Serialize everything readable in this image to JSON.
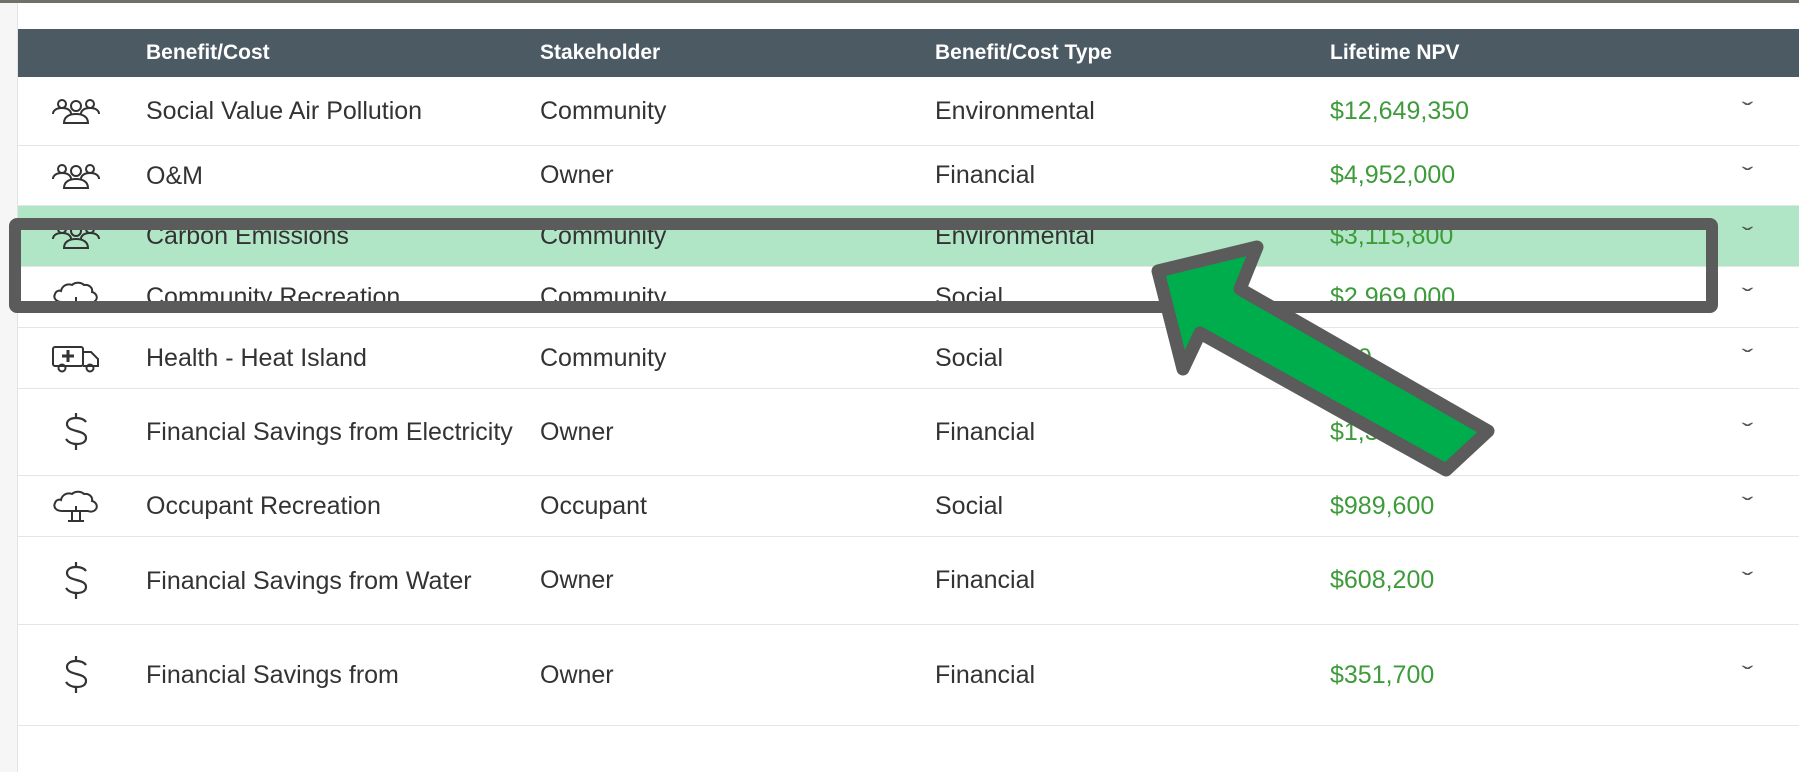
{
  "table": {
    "headers": {
      "benefit_cost": "Benefit/Cost",
      "stakeholder": "Stakeholder",
      "type": "Benefit/Cost Type",
      "npv": "Lifetime NPV"
    },
    "rows": [
      {
        "icon": "people-icon",
        "name": "Social Value Air Pollution",
        "stakeholder": "Community",
        "type": "Environmental",
        "npv": "$12,649,350"
      },
      {
        "icon": "people-icon",
        "name": "O&M",
        "stakeholder": "Owner",
        "type": "Financial",
        "npv": "$4,952,000"
      },
      {
        "icon": "people-icon",
        "name": "Carbon Emissions",
        "stakeholder": "Community",
        "type": "Environmental",
        "npv": "$3,115,800"
      },
      {
        "icon": "tree-icon",
        "name": "Community Recreation",
        "stakeholder": "Community",
        "type": "Social",
        "npv": "$2,969,000"
      },
      {
        "icon": "ambulance-icon",
        "name": "Health - Heat Island",
        "stakeholder": "Community",
        "type": "Social",
        "npv": "800"
      },
      {
        "icon": "dollar-icon",
        "name": "Financial Savings from Electricity",
        "stakeholder": "Owner",
        "type": "Financial",
        "npv": "$1,376,000"
      },
      {
        "icon": "tree-icon",
        "name": "Occupant Recreation",
        "stakeholder": "Occupant",
        "type": "Social",
        "npv": "$989,600"
      },
      {
        "icon": "dollar-icon",
        "name": "Financial Savings from Water",
        "stakeholder": "Owner",
        "type": "Financial",
        "npv": "$608,200"
      },
      {
        "icon": "dollar-icon",
        "name": "Financial Savings from",
        "stakeholder": "Owner",
        "type": "Financial",
        "npv": "$351,700"
      }
    ]
  },
  "colors": {
    "header_bg": "#4b5a63",
    "npv_green": "#3e9b3a",
    "highlight_bg": "#b0e6c6",
    "arrow_fill": "#00ad4c",
    "frame_gray": "#5b5b5b"
  }
}
